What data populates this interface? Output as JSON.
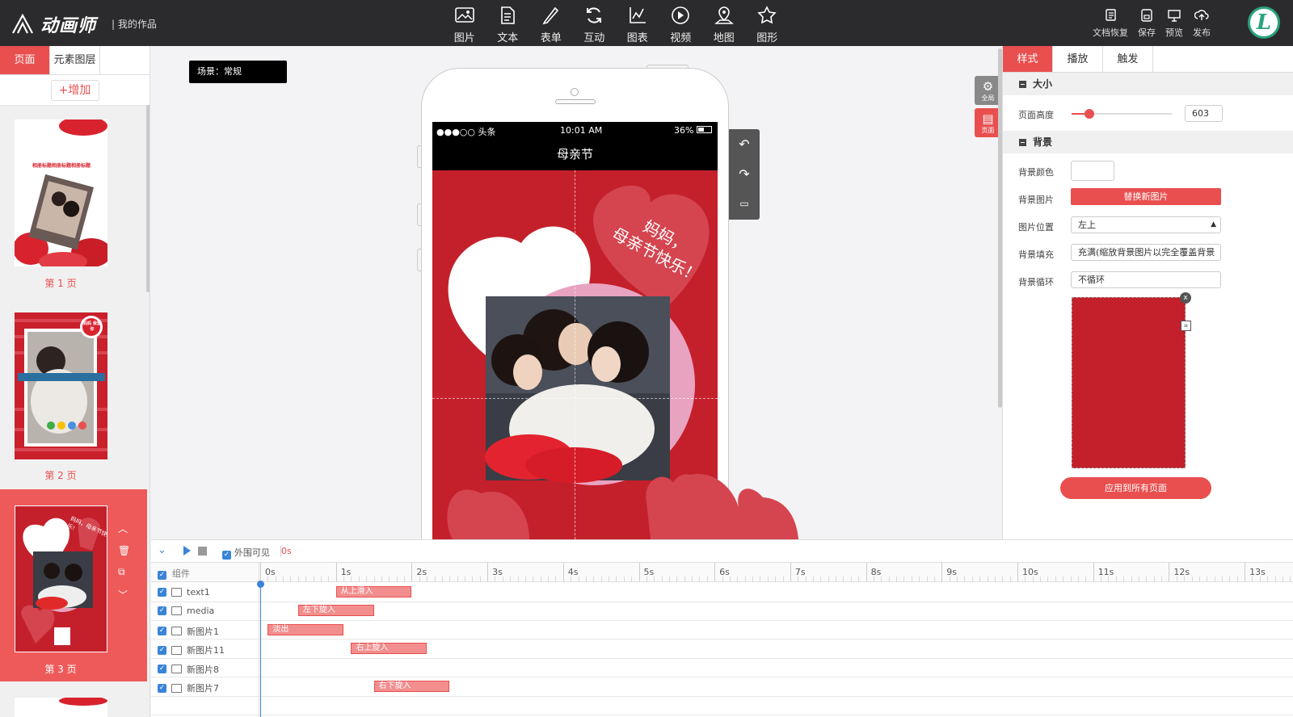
{
  "app": {
    "logo_text": "动画师",
    "my_works": "| 我的作品"
  },
  "toolbar": {
    "tools": [
      {
        "label": "图片",
        "icon": "image-icon"
      },
      {
        "label": "文本",
        "icon": "text-icon"
      },
      {
        "label": "表单",
        "icon": "form-icon"
      },
      {
        "label": "互动",
        "icon": "interact-icon"
      },
      {
        "label": "图表",
        "icon": "chart-icon"
      },
      {
        "label": "视频",
        "icon": "video-icon"
      },
      {
        "label": "地图",
        "icon": "map-icon"
      },
      {
        "label": "图形",
        "icon": "shape-icon"
      }
    ],
    "actions": [
      {
        "label": "文档恢复",
        "icon": "restore-icon"
      },
      {
        "label": "保存",
        "icon": "save-icon"
      },
      {
        "label": "预览",
        "icon": "preview-icon"
      },
      {
        "label": "发布",
        "icon": "publish-icon"
      }
    ],
    "avatar_letter": "L"
  },
  "left_panel": {
    "tabs": [
      "页面",
      "元素图层"
    ],
    "add_button": "+增加",
    "pages": [
      {
        "label": "第 1 页",
        "thumb_text": "相册标题相册标题相册标题"
      },
      {
        "label": "第 2 页",
        "thumb_text": "妈妈 我爱你"
      },
      {
        "label": "第 3 页",
        "thumb_text": "妈妈，母亲节快乐!"
      }
    ]
  },
  "canvas": {
    "scene_label": "场景：常规",
    "status_left": "●●●○○ 头条",
    "status_time": "10:01 AM",
    "status_battery": "36%",
    "page_title": "母亲节",
    "greeting_line1": "妈妈，",
    "greeting_line2": "母亲节快乐！",
    "mode_buttons": [
      "全局",
      "页面"
    ]
  },
  "right_panel": {
    "tabs": [
      "样式",
      "播放",
      "触发"
    ],
    "size_section": "大小",
    "page_height_label": "页面高度",
    "page_height_value": "603",
    "page_height_fraction": 0.18,
    "background_section": "背景",
    "bg_color_label": "背景颜色",
    "bg_image_label": "背景图片",
    "replace_image_button": "替换新图片",
    "image_position_label": "图片位置",
    "image_position_value": "左上",
    "bg_fill_label": "背景填充",
    "bg_fill_value": "充满(缩放背景图片以完全覆盖背景",
    "bg_repeat_label": "背景循环",
    "bg_repeat_value": "不循环",
    "apply_all_button": "应用到所有页面",
    "accent_color": "#e94f4f"
  },
  "timeline": {
    "outside_visible_label": "外围可见",
    "current_time": "0s",
    "component_header": "组件",
    "ticks": [
      "0s",
      "1s",
      "2s",
      "3s",
      "4s",
      "5s",
      "6s",
      "7s",
      "8s",
      "9s",
      "10s",
      "11s",
      "12s",
      "13s"
    ],
    "rows": [
      {
        "name": "text1",
        "icon": "text-file-icon",
        "anim": "从上滑入",
        "start": 1.0,
        "end": 2.0
      },
      {
        "name": "media",
        "icon": "image-icon",
        "anim": "左下旋入",
        "start": 0.5,
        "end": 1.5
      },
      {
        "name": "新图片1",
        "icon": "image-icon",
        "anim": "淡出",
        "start": 0.1,
        "end": 1.1
      },
      {
        "name": "新图片11",
        "icon": "image-icon",
        "anim": "右上旋入",
        "start": 1.2,
        "end": 2.2
      },
      {
        "name": "新图片8",
        "icon": "image-icon",
        "anim": "",
        "start": null,
        "end": null
      },
      {
        "name": "新图片7",
        "icon": "image-icon",
        "anim": "右下旋入",
        "start": 1.5,
        "end": 2.5
      }
    ]
  }
}
